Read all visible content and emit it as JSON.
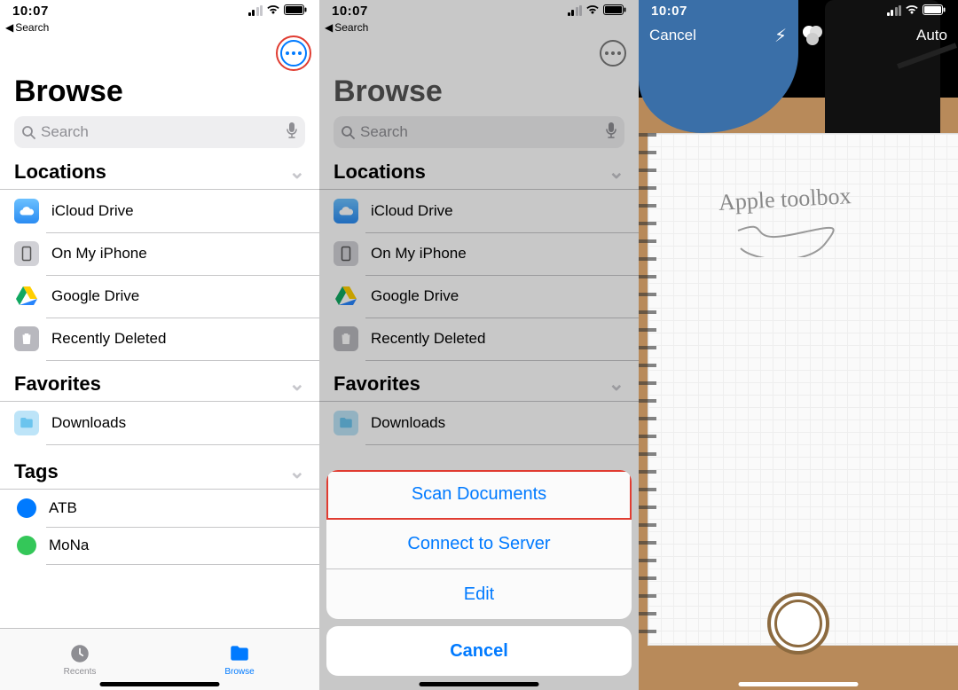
{
  "status": {
    "time": "10:07"
  },
  "back_nav": "Search",
  "browse": {
    "title": "Browse",
    "search_placeholder": "Search",
    "sections": {
      "locations": {
        "header": "Locations",
        "items": [
          {
            "label": "iCloud Drive",
            "icon": "cloud"
          },
          {
            "label": "On My iPhone",
            "icon": "iphone"
          },
          {
            "label": "Google Drive",
            "icon": "drive"
          },
          {
            "label": "Recently Deleted",
            "icon": "trash"
          }
        ]
      },
      "favorites": {
        "header": "Favorites",
        "items": [
          {
            "label": "Downloads",
            "icon": "folder"
          }
        ]
      },
      "tags": {
        "header": "Tags",
        "items": [
          {
            "label": "ATB",
            "color": "#007aff"
          },
          {
            "label": "MoNa",
            "color": "#34c759"
          }
        ]
      }
    },
    "tabs": {
      "recents": "Recents",
      "browse": "Browse"
    }
  },
  "action_sheet": {
    "scan": "Scan Documents",
    "server": "Connect to Server",
    "edit": "Edit",
    "cancel": "Cancel"
  },
  "camera": {
    "cancel": "Cancel",
    "auto": "Auto",
    "handwriting": "Apple toolbox"
  }
}
